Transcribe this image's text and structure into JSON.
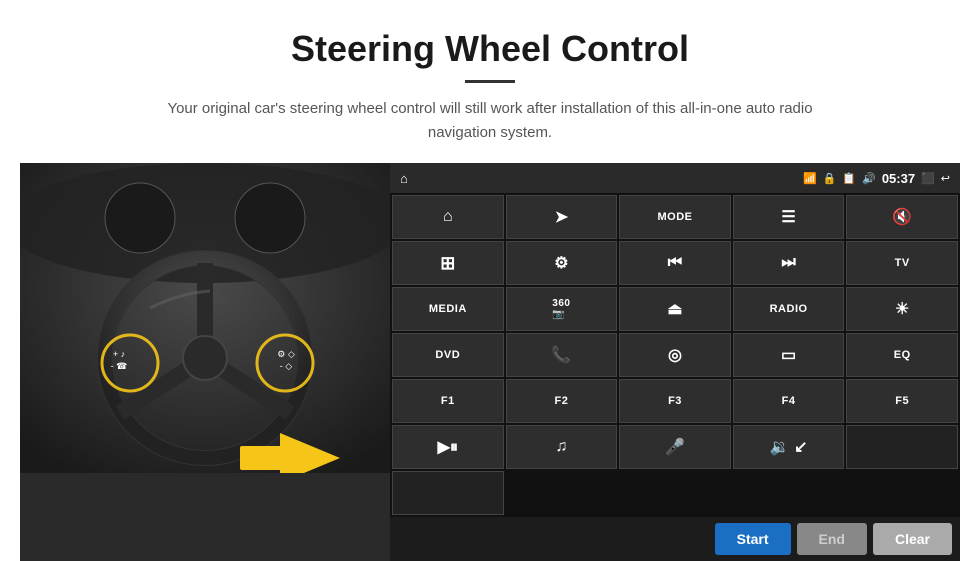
{
  "header": {
    "title": "Steering Wheel Control",
    "divider": true,
    "subtitle": "Your original car's steering wheel control will still work after installation of this all-in-one auto radio navigation system."
  },
  "status_bar": {
    "wifi_icon": "📶",
    "lock_icon": "🔒",
    "sim_icon": "📋",
    "bt_icon": "🔊",
    "time": "05:37",
    "screen_icon": "⬛",
    "back_icon": "↩"
  },
  "buttons": [
    {
      "id": "home",
      "icon": "⌂",
      "text": "",
      "type": "icon"
    },
    {
      "id": "nav",
      "icon": "➤",
      "text": "",
      "type": "icon"
    },
    {
      "id": "mode",
      "icon": "",
      "text": "MODE",
      "type": "text"
    },
    {
      "id": "list",
      "icon": "≡",
      "text": "",
      "type": "icon"
    },
    {
      "id": "mute",
      "icon": "🔇",
      "text": "",
      "type": "icon"
    },
    {
      "id": "apps",
      "icon": "⊞",
      "text": "",
      "type": "icon"
    },
    {
      "id": "settings",
      "icon": "⚙",
      "text": "",
      "type": "icon"
    },
    {
      "id": "prev",
      "icon": "⏮",
      "text": "",
      "type": "icon"
    },
    {
      "id": "next",
      "icon": "⏭",
      "text": "",
      "type": "icon"
    },
    {
      "id": "tv",
      "icon": "",
      "text": "TV",
      "type": "text"
    },
    {
      "id": "media",
      "icon": "",
      "text": "MEDIA",
      "type": "text"
    },
    {
      "id": "cam360",
      "icon": "📷",
      "text": "360",
      "type": "both"
    },
    {
      "id": "eject",
      "icon": "⏏",
      "text": "",
      "type": "icon"
    },
    {
      "id": "radio",
      "icon": "",
      "text": "RADIO",
      "type": "text"
    },
    {
      "id": "bright",
      "icon": "☀",
      "text": "",
      "type": "icon"
    },
    {
      "id": "dvd",
      "icon": "",
      "text": "DVD",
      "type": "text"
    },
    {
      "id": "phone",
      "icon": "📞",
      "text": "",
      "type": "icon"
    },
    {
      "id": "sat",
      "icon": "◎",
      "text": "",
      "type": "icon"
    },
    {
      "id": "screen",
      "icon": "▭",
      "text": "",
      "type": "icon"
    },
    {
      "id": "eq",
      "icon": "",
      "text": "EQ",
      "type": "text"
    },
    {
      "id": "f1",
      "icon": "",
      "text": "F1",
      "type": "text"
    },
    {
      "id": "f2",
      "icon": "",
      "text": "F2",
      "type": "text"
    },
    {
      "id": "f3",
      "icon": "",
      "text": "F3",
      "type": "text"
    },
    {
      "id": "f4",
      "icon": "",
      "text": "F4",
      "type": "text"
    },
    {
      "id": "f5",
      "icon": "",
      "text": "F5",
      "type": "text"
    },
    {
      "id": "playpause",
      "icon": "▶⏸",
      "text": "",
      "type": "icon"
    },
    {
      "id": "music",
      "icon": "♫",
      "text": "",
      "type": "icon"
    },
    {
      "id": "mic",
      "icon": "🎤",
      "text": "",
      "type": "icon"
    },
    {
      "id": "volphone",
      "icon": "🔉",
      "text": "",
      "type": "icon"
    },
    {
      "id": "empty",
      "icon": "",
      "text": "",
      "type": "empty"
    }
  ],
  "action_buttons": {
    "start": "Start",
    "end": "End",
    "clear": "Clear"
  }
}
